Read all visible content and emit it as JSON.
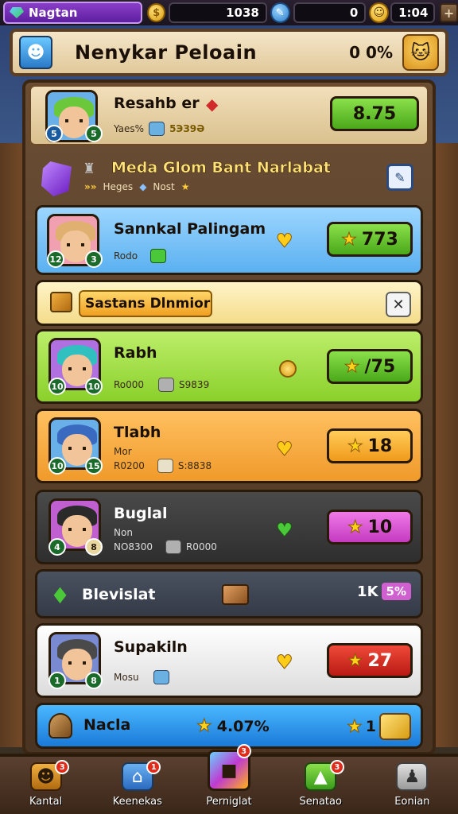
{
  "topbar": {
    "player_name": "Nagtan",
    "coins": "1038",
    "gems": "0",
    "time": "1:04"
  },
  "header": {
    "title": "Nenykar Peloain",
    "percent": "0 0%"
  },
  "player": {
    "name": "Resahb er",
    "sub_label": "Yaes%",
    "sub_value": "5ЭЗ9Ә",
    "level_a": "5",
    "level_b": "5",
    "score": "8.75"
  },
  "league": {
    "title": "Meda Glom Bant Narlabat",
    "sub_a": "Heges",
    "sub_b": "Nost"
  },
  "rows": [
    {
      "name": "Sannkal Palingam",
      "tag": "Rodo",
      "score": "773",
      "lvl_a": "12",
      "lvl_b": "3"
    },
    {
      "name": "Sastans Dlnmior"
    },
    {
      "name": "Rabh",
      "meta1": "Ro000",
      "meta2": "S9839",
      "score": "/75",
      "lvl_a": "10",
      "lvl_b": "10"
    },
    {
      "name": "Tlabh",
      "tag": "Mor",
      "meta1": "R0200",
      "meta2": "S:8838",
      "score": "18",
      "lvl_a": "10",
      "lvl_b": "15"
    },
    {
      "name": "Buglal",
      "tag": "Non",
      "meta1": "NO8300",
      "meta2": "R0000",
      "score": "10",
      "lvl_a": "4",
      "lvl_b": "8"
    },
    {
      "name": "Blevislat",
      "count": "1K",
      "count_badge": "5%"
    },
    {
      "name": "Supakiln",
      "tag": "Mosu",
      "score": "27",
      "lvl_a": "1",
      "lvl_b": "8"
    },
    {
      "name": "Nacla",
      "percent": "4.07%",
      "rank": "1"
    }
  ],
  "nav": [
    {
      "label": "Kantal",
      "badge": "3"
    },
    {
      "label": "Keenekas",
      "badge": "1"
    },
    {
      "label": "Perniglat",
      "badge": "3"
    },
    {
      "label": "Senatao",
      "badge": "3"
    },
    {
      "label": "Eonian",
      "badge": ""
    }
  ]
}
